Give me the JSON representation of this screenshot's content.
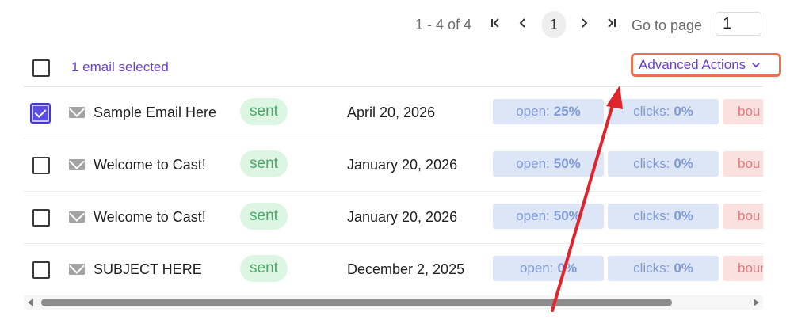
{
  "pagination": {
    "range": "1 - 4 of 4",
    "current_page": "1",
    "go_to_label": "Go to page",
    "go_to_value": "1",
    "icons": [
      "first-page-icon",
      "prev-page-icon",
      "next-page-icon",
      "last-page-icon"
    ]
  },
  "toolbar": {
    "selection_text": "1 email selected",
    "advanced_actions_label": "Advanced Actions"
  },
  "rows": [
    {
      "checked": true,
      "subject": "Sample Email Here",
      "status": "sent",
      "date": "April 20, 2026",
      "open_label": "open:",
      "open_value": "25%",
      "clicks_label": "clicks:",
      "clicks_value": "0%",
      "bounce_label": "bou"
    },
    {
      "checked": false,
      "subject": "Welcome to Cast!",
      "status": "sent",
      "date": "January 20, 2026",
      "open_label": "open:",
      "open_value": "50%",
      "clicks_label": "clicks:",
      "clicks_value": "0%",
      "bounce_label": "bou"
    },
    {
      "checked": false,
      "subject": "Welcome to Cast!",
      "status": "sent",
      "date": "January 20, 2026",
      "open_label": "open:",
      "open_value": "50%",
      "clicks_label": "clicks:",
      "clicks_value": "0%",
      "bounce_label": "bou"
    },
    {
      "checked": false,
      "subject": "SUBJECT HERE",
      "status": "sent",
      "date": "December 2, 2025",
      "open_label": "open:",
      "open_value": "0%",
      "clicks_label": "clicks:",
      "clicks_value": "0%",
      "bounce_label": "bounc"
    }
  ],
  "colors": {
    "accent": "#6a3fd0",
    "highlight_border": "#e8724b",
    "annotation_arrow": "#e0242b",
    "sent_badge_bg": "#ddf5e3",
    "stat_bg": "#dde6f7",
    "bounce_bg": "#fbe0e0"
  }
}
